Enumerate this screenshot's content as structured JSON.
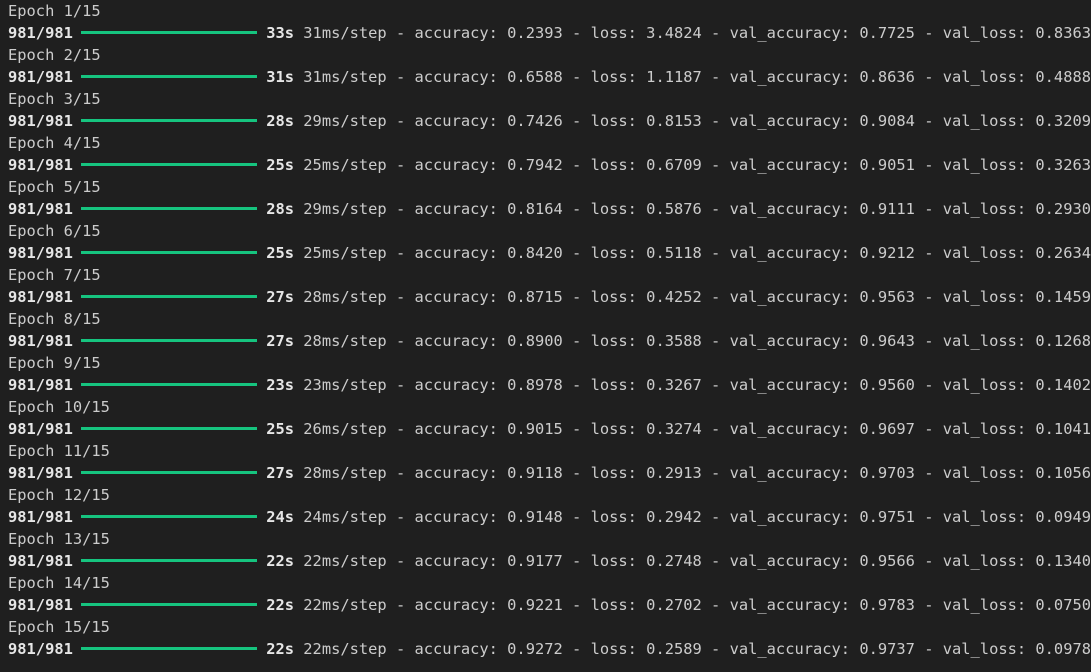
{
  "terminal": {
    "bar_color": "#16c47f",
    "epochs": [
      {
        "header": "Epoch 1/15",
        "steps": "981/981",
        "time": "33s",
        "step_time": "31ms/step",
        "accuracy": "accuracy: 0.2393",
        "loss": "loss: 3.4824",
        "val_accuracy": "val_accuracy: 0.7725",
        "val_loss": "val_loss: 0.8363"
      },
      {
        "header": "Epoch 2/15",
        "steps": "981/981",
        "time": "31s",
        "step_time": "31ms/step",
        "accuracy": "accuracy: 0.6588",
        "loss": "loss: 1.1187",
        "val_accuracy": "val_accuracy: 0.8636",
        "val_loss": "val_loss: 0.4888"
      },
      {
        "header": "Epoch 3/15",
        "steps": "981/981",
        "time": "28s",
        "step_time": "29ms/step",
        "accuracy": "accuracy: 0.7426",
        "loss": "loss: 0.8153",
        "val_accuracy": "val_accuracy: 0.9084",
        "val_loss": "val_loss: 0.3209"
      },
      {
        "header": "Epoch 4/15",
        "steps": "981/981",
        "time": "25s",
        "step_time": "25ms/step",
        "accuracy": "accuracy: 0.7942",
        "loss": "loss: 0.6709",
        "val_accuracy": "val_accuracy: 0.9051",
        "val_loss": "val_loss: 0.3263"
      },
      {
        "header": "Epoch 5/15",
        "steps": "981/981",
        "time": "28s",
        "step_time": "29ms/step",
        "accuracy": "accuracy: 0.8164",
        "loss": "loss: 0.5876",
        "val_accuracy": "val_accuracy: 0.9111",
        "val_loss": "val_loss: 0.2930"
      },
      {
        "header": "Epoch 6/15",
        "steps": "981/981",
        "time": "25s",
        "step_time": "25ms/step",
        "accuracy": "accuracy: 0.8420",
        "loss": "loss: 0.5118",
        "val_accuracy": "val_accuracy: 0.9212",
        "val_loss": "val_loss: 0.2634"
      },
      {
        "header": "Epoch 7/15",
        "steps": "981/981",
        "time": "27s",
        "step_time": "28ms/step",
        "accuracy": "accuracy: 0.8715",
        "loss": "loss: 0.4252",
        "val_accuracy": "val_accuracy: 0.9563",
        "val_loss": "val_loss: 0.1459"
      },
      {
        "header": "Epoch 8/15",
        "steps": "981/981",
        "time": "27s",
        "step_time": "28ms/step",
        "accuracy": "accuracy: 0.8900",
        "loss": "loss: 0.3588",
        "val_accuracy": "val_accuracy: 0.9643",
        "val_loss": "val_loss: 0.1268"
      },
      {
        "header": "Epoch 9/15",
        "steps": "981/981",
        "time": "23s",
        "step_time": "23ms/step",
        "accuracy": "accuracy: 0.8978",
        "loss": "loss: 0.3267",
        "val_accuracy": "val_accuracy: 0.9560",
        "val_loss": "val_loss: 0.1402"
      },
      {
        "header": "Epoch 10/15",
        "steps": "981/981",
        "time": "25s",
        "step_time": "26ms/step",
        "accuracy": "accuracy: 0.9015",
        "loss": "loss: 0.3274",
        "val_accuracy": "val_accuracy: 0.9697",
        "val_loss": "val_loss: 0.1041"
      },
      {
        "header": "Epoch 11/15",
        "steps": "981/981",
        "time": "27s",
        "step_time": "28ms/step",
        "accuracy": "accuracy: 0.9118",
        "loss": "loss: 0.2913",
        "val_accuracy": "val_accuracy: 0.9703",
        "val_loss": "val_loss: 0.1056"
      },
      {
        "header": "Epoch 12/15",
        "steps": "981/981",
        "time": "24s",
        "step_time": "24ms/step",
        "accuracy": "accuracy: 0.9148",
        "loss": "loss: 0.2942",
        "val_accuracy": "val_accuracy: 0.9751",
        "val_loss": "val_loss: 0.0949"
      },
      {
        "header": "Epoch 13/15",
        "steps": "981/981",
        "time": "22s",
        "step_time": "22ms/step",
        "accuracy": "accuracy: 0.9177",
        "loss": "loss: 0.2748",
        "val_accuracy": "val_accuracy: 0.9566",
        "val_loss": "val_loss: 0.1340"
      },
      {
        "header": "Epoch 14/15",
        "steps": "981/981",
        "time": "22s",
        "step_time": "22ms/step",
        "accuracy": "accuracy: 0.9221",
        "loss": "loss: 0.2702",
        "val_accuracy": "val_accuracy: 0.9783",
        "val_loss": "val_loss: 0.0750"
      },
      {
        "header": "Epoch 15/15",
        "steps": "981/981",
        "time": "22s",
        "step_time": "22ms/step",
        "accuracy": "accuracy: 0.9272",
        "loss": "loss: 0.2589",
        "val_accuracy": "val_accuracy: 0.9737",
        "val_loss": "val_loss: 0.0978"
      }
    ]
  }
}
